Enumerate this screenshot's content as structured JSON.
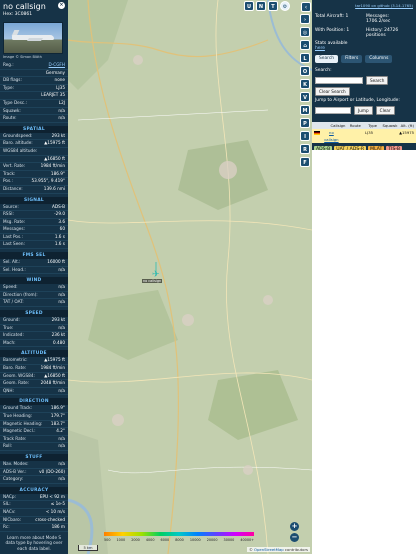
{
  "sidebar": {
    "callsign": "no callsign",
    "hex": "Hex: 3C0861",
    "close": "×",
    "photo_credit": "Image © Simon Blöth",
    "info": [
      {
        "k": "Reg.:",
        "v": "D-CGFH",
        "link": true
      },
      {
        "k": "",
        "v": "Germany"
      },
      {
        "k": "DB flags:",
        "v": "none"
      },
      {
        "k": "Type:",
        "v": "LJ35"
      },
      {
        "k": "",
        "v": "LEARJET 35"
      },
      {
        "k": "Type Desc.:",
        "v": "L2J"
      },
      {
        "k": "Squawk:",
        "v": "n/a"
      },
      {
        "k": "Route:",
        "v": "n/a"
      }
    ],
    "sections": [
      {
        "title": "SPATIAL",
        "rows": [
          {
            "k": "Groundspeed:",
            "v": "293 kt"
          },
          {
            "k": "Baro. altitude:",
            "v": "▲15975 ft"
          },
          {
            "k": "WGS84 altitude:",
            "v": ""
          },
          {
            "k": "",
            "v": "▲16850 ft"
          },
          {
            "k": "Vert. Rate:",
            "v": "1984 ft/min"
          },
          {
            "k": "Track:",
            "v": "186.9°"
          },
          {
            "k": "Pos.:",
            "v": "53.955°, 9.419°"
          },
          {
            "k": "Distance:",
            "v": "139.6 nmi"
          }
        ]
      },
      {
        "title": "SIGNAL",
        "rows": [
          {
            "k": "Source:",
            "v": "ADS-B"
          },
          {
            "k": "RSSI:",
            "v": "-29.0"
          },
          {
            "k": "Msg. Rate:",
            "v": "3.6"
          },
          {
            "k": "Messages:",
            "v": "60"
          },
          {
            "k": "Last Pos.:",
            "v": "1.6 s"
          },
          {
            "k": "Last Seen:",
            "v": "1.6 s"
          }
        ]
      },
      {
        "title": "FMS SEL",
        "rows": [
          {
            "k": "Sel. Alt.:",
            "v": "16000 ft"
          },
          {
            "k": "Sel. Head.:",
            "v": "n/a"
          }
        ]
      },
      {
        "title": "WIND",
        "rows": [
          {
            "k": "Speed:",
            "v": "n/a"
          },
          {
            "k": "Direction (from):",
            "v": "n/a"
          },
          {
            "k": "TAT / OAT:",
            "v": "n/a"
          }
        ]
      },
      {
        "title": "SPEED",
        "rows": [
          {
            "k": "Ground:",
            "v": "293 kt"
          },
          {
            "k": "True:",
            "v": "n/a"
          },
          {
            "k": "Indicated:",
            "v": "236 kt"
          },
          {
            "k": "Mach:",
            "v": "0.480"
          }
        ]
      },
      {
        "title": "ALTITUDE",
        "rows": [
          {
            "k": "Barometric:",
            "v": "▲15975 ft"
          },
          {
            "k": "Baro. Rate:",
            "v": "1984 ft/min"
          },
          {
            "k": "Geom. WGS84:",
            "v": "▲16850 ft"
          },
          {
            "k": "Geom. Rate:",
            "v": "2048 ft/min"
          },
          {
            "k": "QNH:",
            "v": "n/a"
          }
        ]
      },
      {
        "title": "DIRECTION",
        "rows": [
          {
            "k": "Ground Track:",
            "v": "186.9°"
          },
          {
            "k": "True Heading:",
            "v": "179.7°"
          },
          {
            "k": "Magnetic Heading:",
            "v": "183.7°"
          },
          {
            "k": "Magnetic Decl.:",
            "v": "4.2°"
          },
          {
            "k": "Track Rate:",
            "v": "n/a"
          },
          {
            "k": "Roll:",
            "v": "n/a"
          }
        ]
      },
      {
        "title": "STUFF",
        "rows": [
          {
            "k": "Nav. Modes:",
            "v": "n/a"
          },
          {
            "k": "ADS-B Ver.:",
            "v": "v0 (DO-260)"
          },
          {
            "k": "Category:",
            "v": "n/a"
          }
        ]
      },
      {
        "title": "ACCURACY",
        "rows": [
          {
            "k": "NACp:",
            "v": "EPU < 92 m"
          },
          {
            "k": "SIL:",
            "v": "≤ 1e-5"
          },
          {
            "k": "NACv:",
            "v": "< 10 m/s"
          },
          {
            "k": "NICbaro:",
            "v": "cross-checked"
          },
          {
            "k": "Rc:",
            "v": "186 m"
          }
        ]
      }
    ],
    "footer": "Learn more about Mode S data type by hovering over each data label."
  },
  "map": {
    "top_buttons": [
      "U",
      "N",
      "T"
    ],
    "side_buttons": [
      "L",
      "O",
      "K",
      "V",
      "M",
      "P",
      "I",
      "R",
      "F"
    ],
    "zoom_in": "+",
    "zoom_out": "−",
    "scale_label": "5 km",
    "attribution_prefix": "© ",
    "attribution_link": "OpenStreetMap",
    "attribution_suffix": " contributors",
    "legend_labels": [
      "500",
      "1000",
      "2000",
      "4000",
      "6000",
      "8000",
      "10000",
      "20000",
      "30000",
      "40000+"
    ],
    "aircraft_label": "no callsign"
  },
  "right": {
    "link": "tar1090 on github (3.14.1765)",
    "total_label": "Total Aircraft: 1",
    "messages_label": "Messages:",
    "messages_value": "1706.2/sec",
    "withpos_label": "With Position: 1",
    "history_label": "History: 24726",
    "history_value": "positions",
    "stats_label": "Stats available",
    "stats_link": "here",
    "tabs": [
      "Search",
      "Filters",
      "Columns"
    ],
    "search_label": "Search:",
    "search_btn": "Search",
    "clear_btn": "Clear Search",
    "jump_label": "Jump to Airport or Latitude, Longitude:",
    "jump_btn": "Jump",
    "jclear_btn": "Clear",
    "table_headers": [
      "",
      "Callsign",
      "Route",
      "Type",
      "Squawk",
      "Alt. (ft)"
    ],
    "table_row": [
      "",
      "no callsign",
      "",
      "LJ35",
      "",
      "▲15975"
    ],
    "chips": [
      {
        "label": "ADS-B",
        "color": "#a9d18e"
      },
      {
        "label": "UAT / ADS-R",
        "color": "#f3d15c"
      },
      {
        "label": "MLAT",
        "color": "#f5b041"
      },
      {
        "label": "TIS-B",
        "color": "#f1948a"
      },
      {
        "label": "Mode-S",
        "color": "#aed6f1"
      },
      {
        "label": "AIS",
        "color": "#d7bde2"
      },
      {
        "label": "ADS-C",
        "color": "#7dcea0"
      }
    ]
  }
}
